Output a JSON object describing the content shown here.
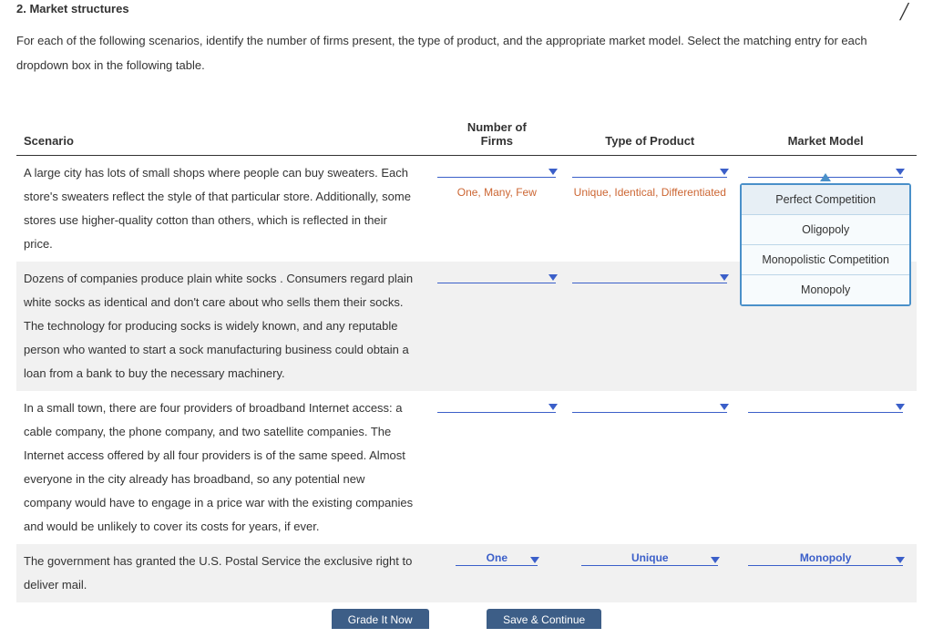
{
  "heading": "2. Market structures",
  "instructions": "For each of the following scenarios, identify the number of firms present, the type of product, and the appropriate market model. Select the matching entry for each dropdown box in the following table.",
  "columns": {
    "scenario": "Scenario",
    "firms_top": "Number of",
    "firms": "Firms",
    "product": "Type of Product",
    "model": "Market Model"
  },
  "rows": [
    {
      "scenario": "A large city has lots of small shops where people can buy sweaters. Each store's sweaters reflect the style of that particular store. Additionally, some stores use higher-quality cotton than others, which is reflected in their price.",
      "firms_hint": "One, Many, Few",
      "product_hint": "Unique, Identical, Differentiated",
      "model_open": true
    },
    {
      "scenario": "Dozens of companies produce plain white socks . Consumers regard plain white socks as identical and don't care about who sells them their socks. The technology for producing socks is widely known, and any reputable person who wanted to start a sock manufacturing business could obtain a loan from a bank to buy the necessary machinery."
    },
    {
      "scenario": "In a small town, there are four providers of broadband Internet access: a cable company, the phone company, and two satellite companies. The Internet access offered by all four providers is of the same speed. Almost everyone in the city already has broadband, so any potential new company would have to engage in a price war with the existing companies and would be unlikely to cover its costs for years, if ever."
    },
    {
      "scenario": "The government has granted the U.S. Postal Service the exclusive right to deliver mail.",
      "firms_value": "One",
      "product_value": "Unique",
      "model_value": "Monopoly"
    }
  ],
  "model_options": [
    "Perfect Competition",
    "Oligopoly",
    "Monopolistic Competition",
    "Monopoly"
  ],
  "footer": {
    "grade": "Grade It Now",
    "save": "Save & Continue"
  }
}
